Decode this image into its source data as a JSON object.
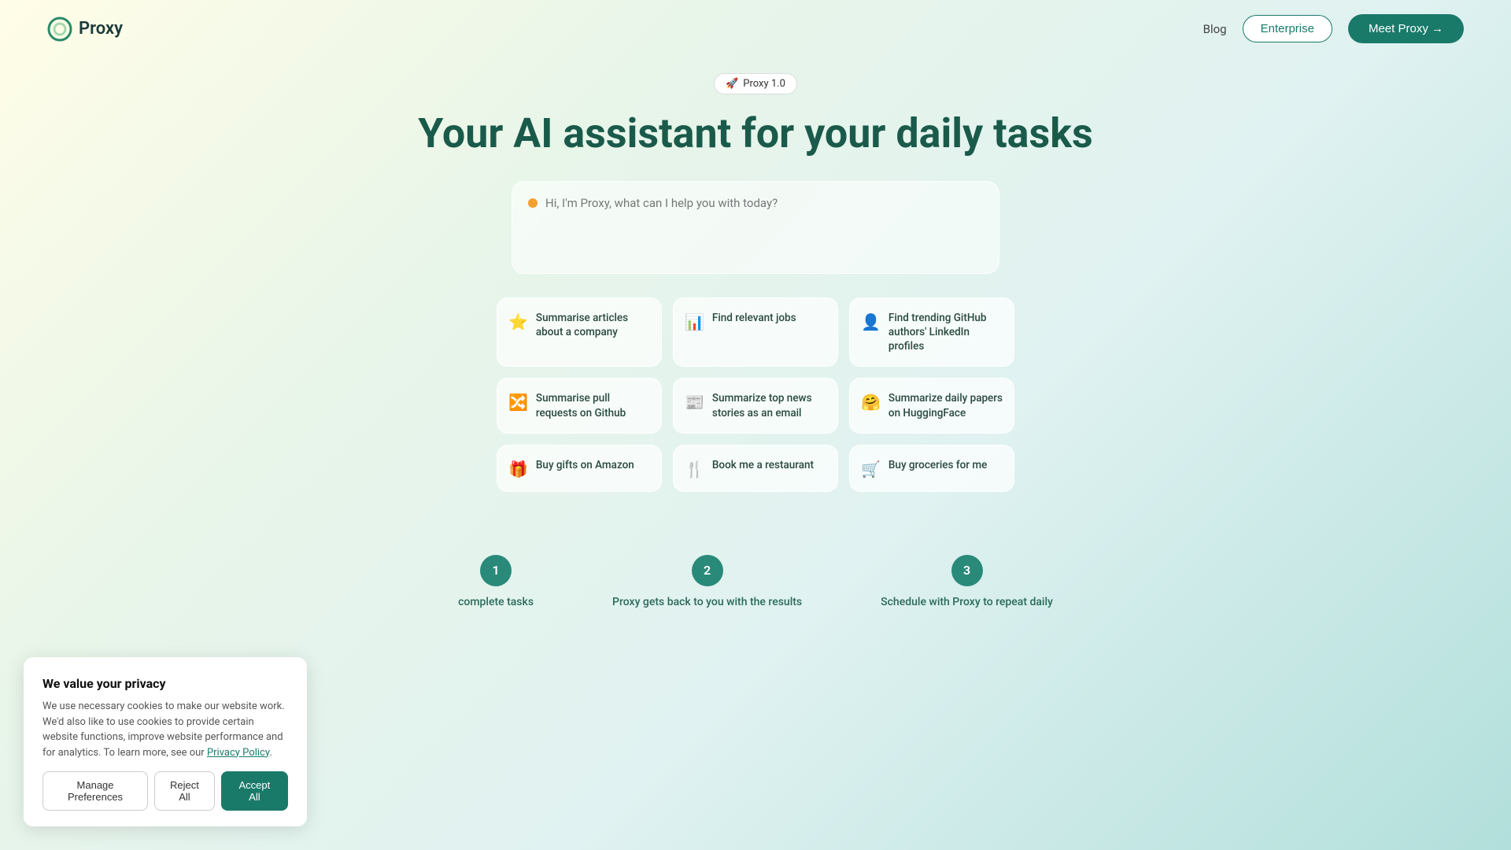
{
  "nav": {
    "logo_text": "Proxy",
    "blog_label": "Blog",
    "enterprise_label": "Enterprise",
    "meet_proxy_label": "Meet Proxy →"
  },
  "hero": {
    "badge_emoji": "🚀",
    "badge_label": "Proxy 1.0",
    "headline": "Your AI assistant for your daily tasks",
    "chat_placeholder": "Hi, I'm Proxy, what can I help you with today?"
  },
  "cards": [
    {
      "icon": "⭐",
      "icon_name": "star-icon",
      "text": "Summarise articles about a company",
      "color": "purple"
    },
    {
      "icon": "📊",
      "icon_name": "bar-chart-icon",
      "text": "Find relevant jobs",
      "color": "teal"
    },
    {
      "icon": "👤",
      "icon_name": "user-search-icon",
      "text": "Find trending GitHub authors' LinkedIn profiles",
      "color": "orange"
    },
    {
      "icon": "🔀",
      "icon_name": "git-merge-icon",
      "text": "Summarise pull requests on Github",
      "color": "pink"
    },
    {
      "icon": "📰",
      "icon_name": "newspaper-icon",
      "text": "Summarize top news stories as an email",
      "color": "teal"
    },
    {
      "icon": "🤗",
      "icon_name": "hugging-face-icon",
      "text": "Summarize daily papers on HuggingFace",
      "color": "yellow"
    },
    {
      "icon": "🎁",
      "icon_name": "gift-icon",
      "text": "Buy gifts on Amazon",
      "color": "orange"
    },
    {
      "icon": "🍴",
      "icon_name": "restaurant-icon",
      "text": "Book me a restaurant",
      "color": "teal"
    },
    {
      "icon": "🛒",
      "icon_name": "cart-icon",
      "text": "Buy groceries for me",
      "color": "orange"
    }
  ],
  "steps": [
    {
      "number": "1",
      "label": "complete tasks"
    },
    {
      "number": "2",
      "label": "Proxy gets back to you with the results"
    },
    {
      "number": "3",
      "label": "Schedule with Proxy to repeat daily"
    }
  ],
  "privacy": {
    "title": "We value your privacy",
    "body": "We use necessary cookies to make our website work. We'd also like to use cookies to provide certain website functions, improve website performance and for analytics. To learn more, see our",
    "link_text": "Privacy Policy",
    "manage_label": "Manage Preferences",
    "reject_label": "Reject All",
    "accept_label": "Accept All"
  }
}
